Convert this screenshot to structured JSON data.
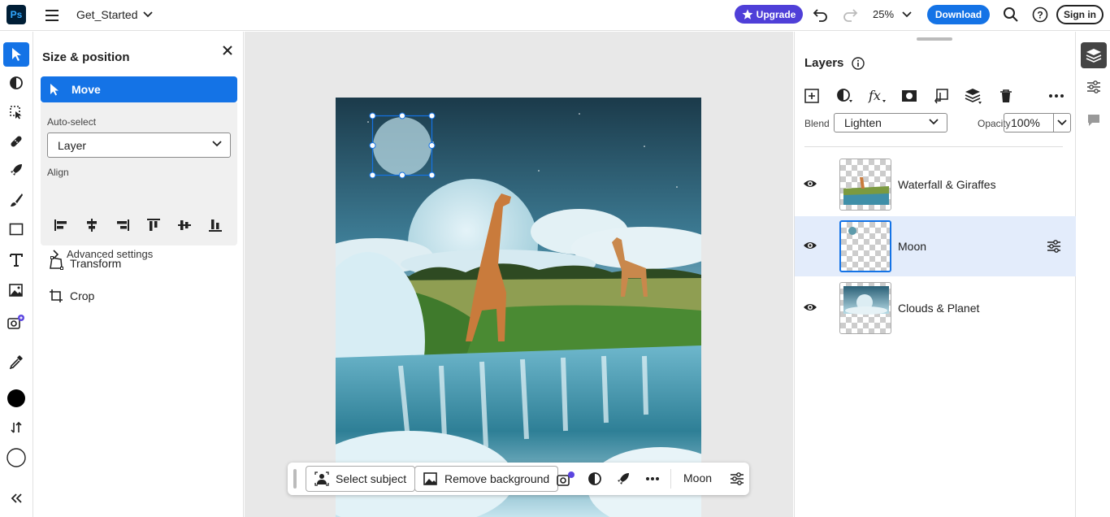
{
  "app": {
    "logo": "Ps",
    "document_title": "Get_Started"
  },
  "topbar": {
    "upgrade_label": "Upgrade",
    "zoom_level": "25%",
    "download_label": "Download",
    "signin_label": "Sign in"
  },
  "toolbar": {
    "tools": [
      "move-icon",
      "adjust-icon",
      "select-icon",
      "heal-icon",
      "quick-actions-icon",
      "brush-icon",
      "shape-icon",
      "type-icon",
      "image-icon",
      "generative-fill-icon",
      "eyedropper-icon"
    ],
    "foreground_color": "#000000",
    "background_color": "#ffffff"
  },
  "size_position": {
    "title": "Size & position",
    "move_label": "Move",
    "auto_select_label": "Auto-select",
    "auto_select_value": "Layer",
    "align_label": "Align",
    "advanced_label": "Advanced settings",
    "transform_label": "Transform",
    "crop_label": "Crop"
  },
  "context_bar": {
    "select_subject": "Select subject",
    "remove_background": "Remove background",
    "layer_name": "Moon"
  },
  "layers_panel": {
    "title": "Layers",
    "blend_label": "Blend",
    "blend_value": "Lighten",
    "opacity_label": "Opacity",
    "opacity_value": "100%",
    "layers": [
      {
        "name": "Waterfall & Giraffes",
        "visible": true,
        "selected": false
      },
      {
        "name": "Moon",
        "visible": true,
        "selected": true
      },
      {
        "name": "Clouds & Planet",
        "visible": true,
        "selected": false
      }
    ]
  },
  "colors": {
    "accent": "#1473e6",
    "upgrade": "#4f3fd8",
    "selected_row": "#e3ecfb"
  }
}
